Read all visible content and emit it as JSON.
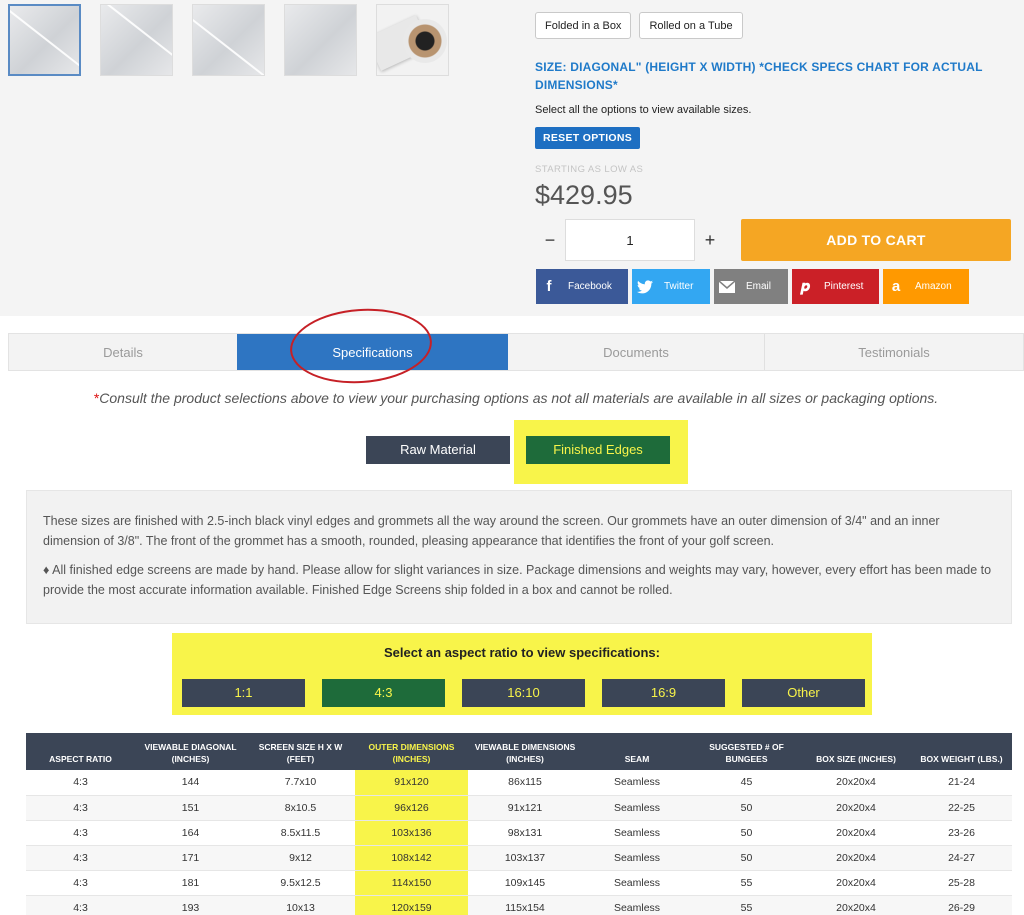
{
  "gallery": {
    "thumbnails": [
      "fold-screen-1",
      "fold-screen-2",
      "fold-screen-3",
      "fold-screen-4",
      "roll-tube"
    ]
  },
  "packaging": {
    "options": [
      "Folded in a Box",
      "Rolled on a Tube"
    ]
  },
  "size": {
    "title": "SIZE: DIAGONAL\" (HEIGHT X WIDTH) *CHECK SPECS CHART FOR ACTUAL DIMENSIONS*",
    "note": "Select all the options to view available sizes.",
    "reset_label": "RESET OPTIONS"
  },
  "pricing": {
    "starting_label": "STARTING AS LOW AS",
    "price": "$429.95"
  },
  "cart": {
    "minus": "−",
    "quantity": "1",
    "plus": "+",
    "add_label": "ADD TO CART"
  },
  "share": {
    "facebook": "Facebook",
    "twitter": "Twitter",
    "email": "Email",
    "pinterest": "Pinterest",
    "amazon": "Amazon"
  },
  "tabs": {
    "details": "Details",
    "specifications": "Specifications",
    "documents": "Documents",
    "testimonials": "Testimonials"
  },
  "consult": {
    "asterisk": "*",
    "text": "Consult the product selections above to view your purchasing options as not all materials are available in all sizes or packaging options."
  },
  "edge_toggle": {
    "raw": "Raw Material",
    "finished": "Finished Edges"
  },
  "description": {
    "p1": "These sizes are finished with 2.5-inch black vinyl edges and grommets all the way around the screen. Our grommets have an outer dimension of 3/4\" and an inner dimension of 3/8\". The front of the grommet has a smooth, rounded, pleasing appearance that identifies the front of your golf screen.",
    "p2": "♦ All finished edge screens are made by hand. Please allow for slight variances in size. Package dimensions and weights may vary, however, every effort has been made to provide the most accurate information available. Finished Edge Screens ship folded in a box and cannot be rolled."
  },
  "aspect": {
    "title": "Select an aspect ratio to view specifications:",
    "options": [
      "1:1",
      "4:3",
      "16:10",
      "16:9",
      "Other"
    ],
    "selected": "4:3"
  },
  "table": {
    "headers": [
      "ASPECT RATIO",
      "VIEWABLE DIAGONAL (INCHES)",
      "SCREEN SIZE H X W (FEET)",
      "OUTER DIMENSIONS (INCHES)",
      "VIEWABLE DIMENSIONS (INCHES)",
      "SEAM",
      "SUGGESTED # OF BUNGEES",
      "BOX SIZE (INCHES)",
      "BOX WEIGHT (LBS.)"
    ],
    "rows": [
      [
        "4:3",
        "144",
        "7.7x10",
        "91x120",
        "86x115",
        "Seamless",
        "45",
        "20x20x4",
        "21-24"
      ],
      [
        "4:3",
        "151",
        "8x10.5",
        "96x126",
        "91x121",
        "Seamless",
        "50",
        "20x20x4",
        "22-25"
      ],
      [
        "4:3",
        "164",
        "8.5x11.5",
        "103x136",
        "98x131",
        "Seamless",
        "50",
        "20x20x4",
        "23-26"
      ],
      [
        "4:3",
        "171",
        "9x12",
        "108x142",
        "103x137",
        "Seamless",
        "50",
        "20x20x4",
        "24-27"
      ],
      [
        "4:3",
        "181",
        "9.5x12.5",
        "114x150",
        "109x145",
        "Seamless",
        "55",
        "20x20x4",
        "25-28"
      ],
      [
        "4:3",
        "193",
        "10x13",
        "120x159",
        "115x154",
        "Seamless",
        "55",
        "20x20x4",
        "26-29"
      ]
    ]
  },
  "colors": {
    "accent_blue": "#2e75c2",
    "cart_orange": "#f5a623",
    "highlight_yellow": "#f8f44a",
    "dark_button": "#3b4556",
    "active_green": "#1e6b3a",
    "annotation_red": "#c62026"
  }
}
